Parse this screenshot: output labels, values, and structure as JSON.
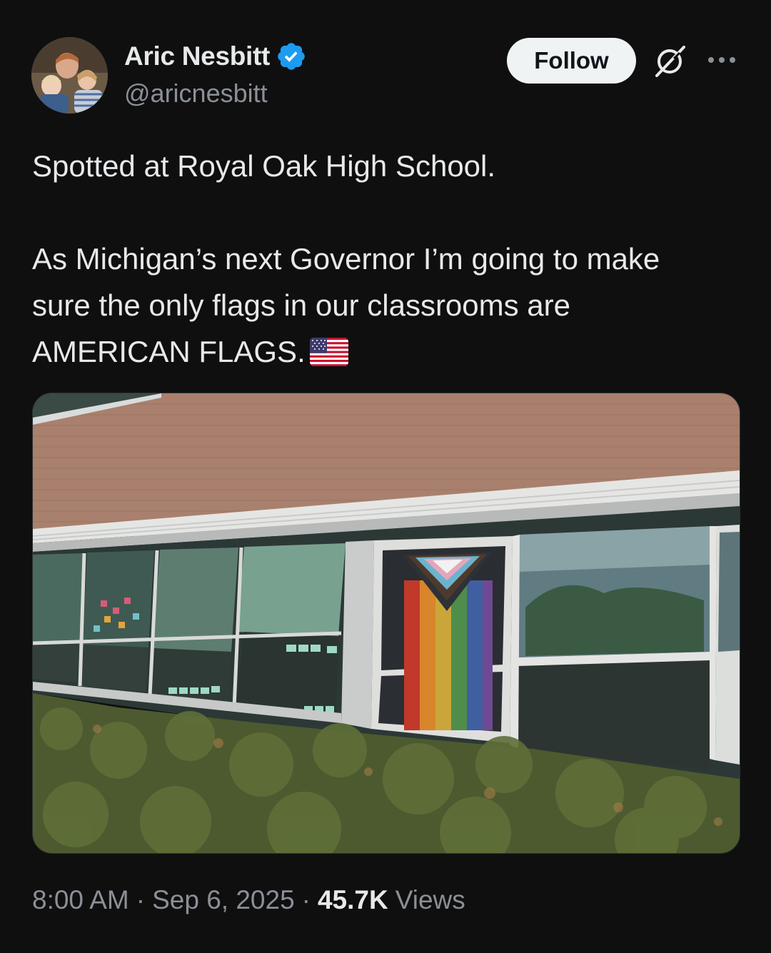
{
  "author": {
    "name": "Aric Nesbitt",
    "handle": "@aricnesbitt",
    "verified": true,
    "verified_color": "#1d9bf0"
  },
  "actions": {
    "follow_label": "Follow",
    "grok_icon": "grok-icon",
    "more_icon": "more-icon"
  },
  "tweet": {
    "line1": "Spotted at Royal Oak High School.",
    "line2": "As Michigan’s next Governor I’m going to make",
    "line3": "sure the only flags in our classrooms are",
    "line4": "AMERICAN FLAGS.",
    "emoji": "us-flag-emoji"
  },
  "media": {
    "type": "photo"
  },
  "meta": {
    "time": "8:00 AM",
    "separator": "·",
    "date": "Sep 6, 2025",
    "views_count": "45.7K",
    "views_label": "Views"
  }
}
